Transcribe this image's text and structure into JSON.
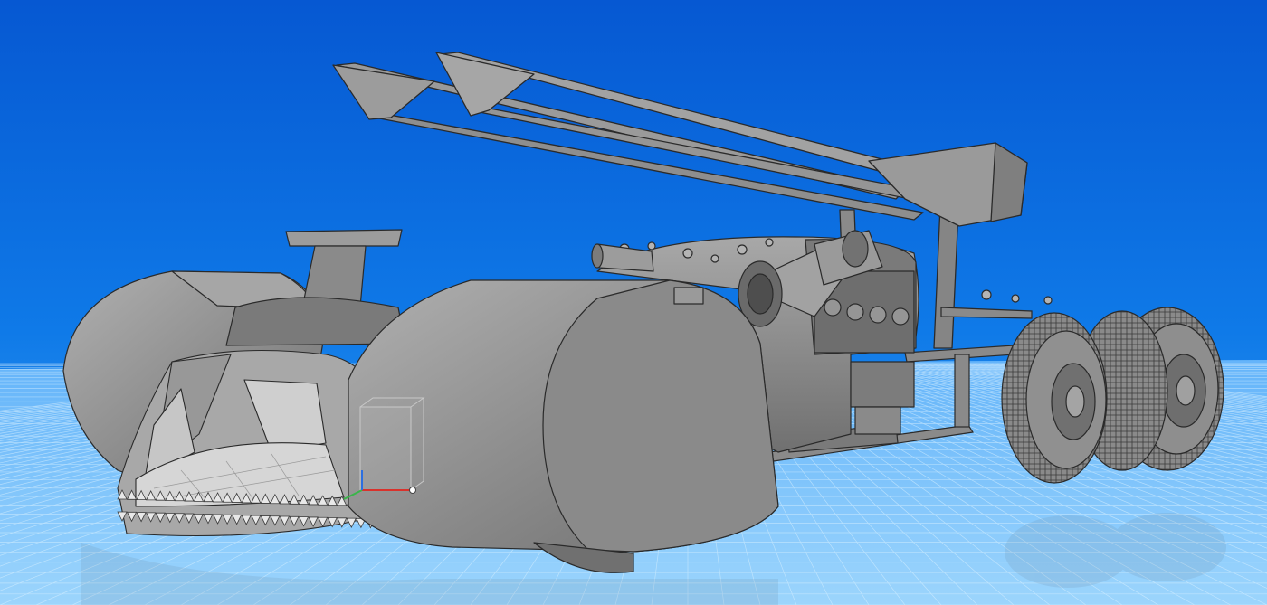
{
  "viewport": {
    "background_top": "#0660d8",
    "background_bottom": "#1a8cf2",
    "floor_color": "#8fd0ff",
    "grid_color": "#d8f0ff",
    "model_fill": "#8c8c8c",
    "model_fill_light": "#a4a4a4",
    "model_fill_dark": "#6c6c6c",
    "edge_color": "#2a2a2a",
    "tire_color": "#7a7a7a"
  },
  "scene": {
    "objects": [
      "left-front-fender",
      "right-front-fender",
      "shark-nose",
      "teeth-row",
      "headrest-fin",
      "engine-block",
      "exhaust-stacks",
      "rear-wing",
      "chassis-rails",
      "rear-dual-wheels"
    ]
  },
  "gizmo": {
    "axes": [
      "x-axis",
      "y-axis",
      "z-axis"
    ],
    "x_color": "#d9322c",
    "y_color": "#3ab54a",
    "z_color": "#2c6fe0"
  }
}
